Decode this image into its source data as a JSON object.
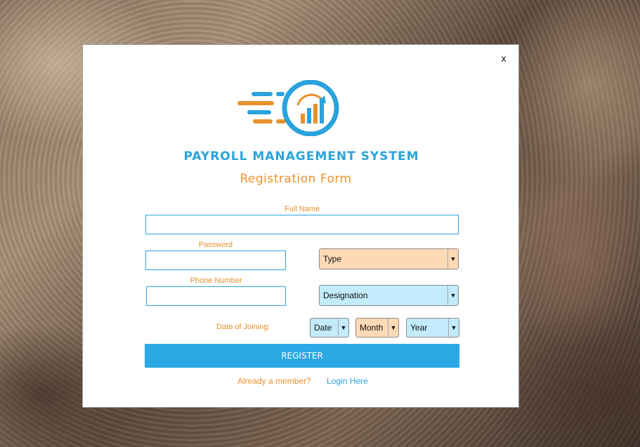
{
  "window": {
    "close_label": "x"
  },
  "brand": {
    "app_title": "PAYROLL MANAGEMENT SYSTEM",
    "form_title": "Registration Form",
    "logo_icon": "payroll-growth-chart-logo-icon",
    "colors": {
      "blue": "#2aa3dc",
      "orange": "#e8922c"
    }
  },
  "fields": {
    "full_name_label": "Full Name",
    "full_name_value": "",
    "password_label": "Password",
    "password_value": "",
    "phone_label": "Phone Number",
    "phone_value": ""
  },
  "selects": {
    "type": "Type",
    "designation": "Designation",
    "date_label": "Date of Joining:",
    "date": "Date",
    "month": "Month",
    "year": "Year"
  },
  "actions": {
    "register_label": "REGISTER",
    "already_member": "Already a member?",
    "login_link": "Login Here"
  }
}
